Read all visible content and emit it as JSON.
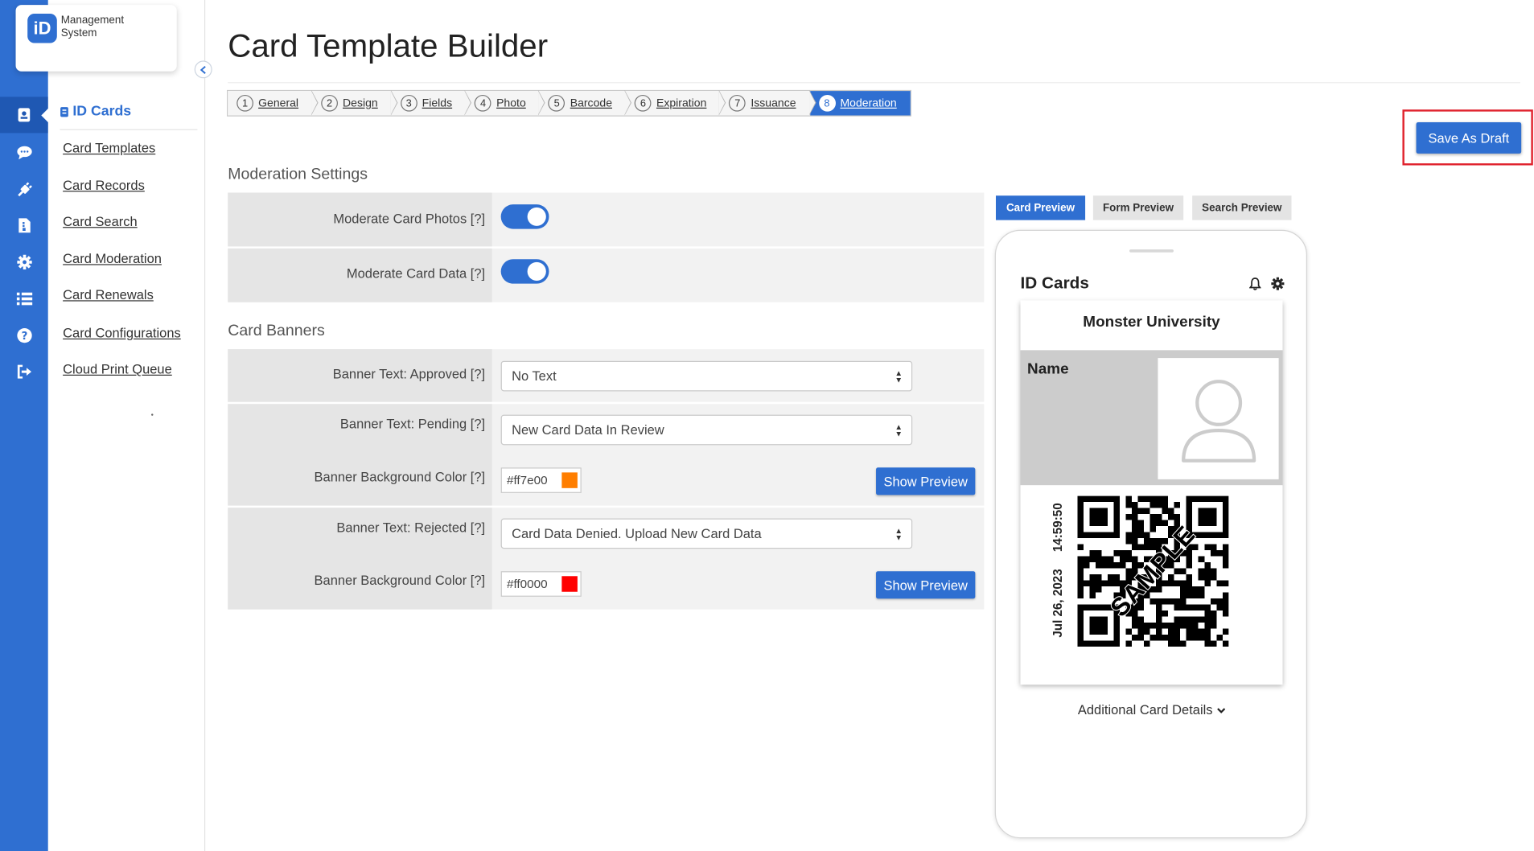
{
  "app": {
    "logo_mark": "iD",
    "logo_line1": "Management",
    "logo_line2": "System"
  },
  "rail_icons": [
    "id-card-icon",
    "chat-icon",
    "plug-icon",
    "document-icon",
    "gear-icon",
    "list-icon",
    "help-icon",
    "sign-out-icon"
  ],
  "nav": {
    "section_title": "ID Cards",
    "links": [
      "Card Templates",
      "Card Records",
      "Card Search",
      "Card Moderation",
      "Card Renewals",
      "Card Configurations",
      "Cloud Print Queue"
    ]
  },
  "page": {
    "title": "Card Template Builder",
    "save_draft_label": "Save As Draft"
  },
  "steps": [
    {
      "num": "1",
      "label": "General"
    },
    {
      "num": "2",
      "label": "Design"
    },
    {
      "num": "3",
      "label": "Fields"
    },
    {
      "num": "4",
      "label": "Photo"
    },
    {
      "num": "5",
      "label": "Barcode"
    },
    {
      "num": "6",
      "label": "Expiration"
    },
    {
      "num": "7",
      "label": "Issuance"
    },
    {
      "num": "8",
      "label": "Moderation",
      "active": true
    }
  ],
  "moderation": {
    "heading": "Moderation Settings",
    "photos_label": "Moderate Card Photos [?]",
    "photos_on": true,
    "data_label": "Moderate Card Data [?]",
    "data_on": true
  },
  "banners": {
    "heading": "Card Banners",
    "approved_label": "Banner Text: Approved [?]",
    "approved_value": "No Text",
    "pending_label": "Banner Text: Pending [?]",
    "pending_value": "New Card Data In Review",
    "pending_bg_label": "Banner Background Color [?]",
    "pending_bg_value": "#ff7e00",
    "pending_bg_color": "#ff7e00",
    "rejected_label": "Banner Text: Rejected [?]",
    "rejected_value": "Card Data Denied. Upload New Card Data",
    "rejected_bg_label": "Banner Background Color [?]",
    "rejected_bg_value": "#ff0000",
    "rejected_bg_color": "#ff0000",
    "show_preview_label": "Show Preview"
  },
  "preview": {
    "tabs": [
      "Card Preview",
      "Form Preview",
      "Search Preview"
    ],
    "active_tab": "Card Preview",
    "app_title": "ID Cards",
    "school": "Monster University",
    "name_label": "Name",
    "date": "Jul 26, 2023",
    "time": "14:59:50",
    "watermark": "SAMPLE",
    "more_details": "Additional Card Details"
  },
  "colors": {
    "accent": "#2f6fd1",
    "highlight": "#e0232e"
  }
}
